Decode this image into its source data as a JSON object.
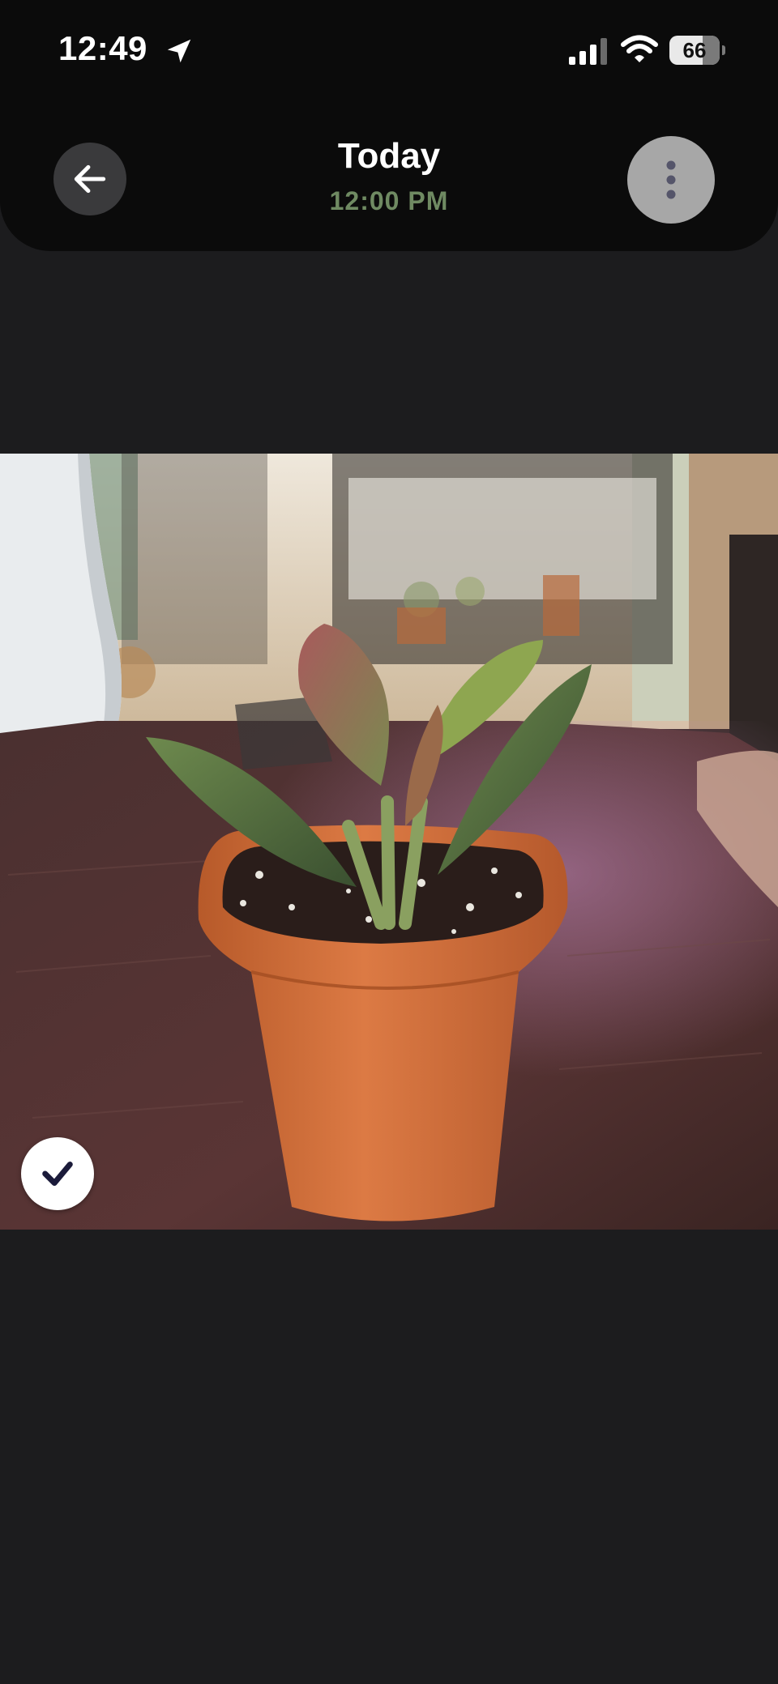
{
  "status_bar": {
    "time": "12:49",
    "battery": "66",
    "icons": [
      "location-arrow-icon",
      "cellular-signal-icon",
      "wifi-icon",
      "battery-icon"
    ]
  },
  "header": {
    "title": "Today",
    "subtitle": "12:00 PM",
    "back_icon": "arrow-left-icon",
    "more_icon": "vertical-ellipsis-icon"
  },
  "photo": {
    "selected_icon": "checkmark-icon"
  },
  "colors": {
    "background": "#1c1c1e",
    "header_background": "#0b0b0b",
    "subtitle_green": "#6f8a62",
    "more_button": "#a7a7a7",
    "check_mark": "#1b1b3a"
  }
}
